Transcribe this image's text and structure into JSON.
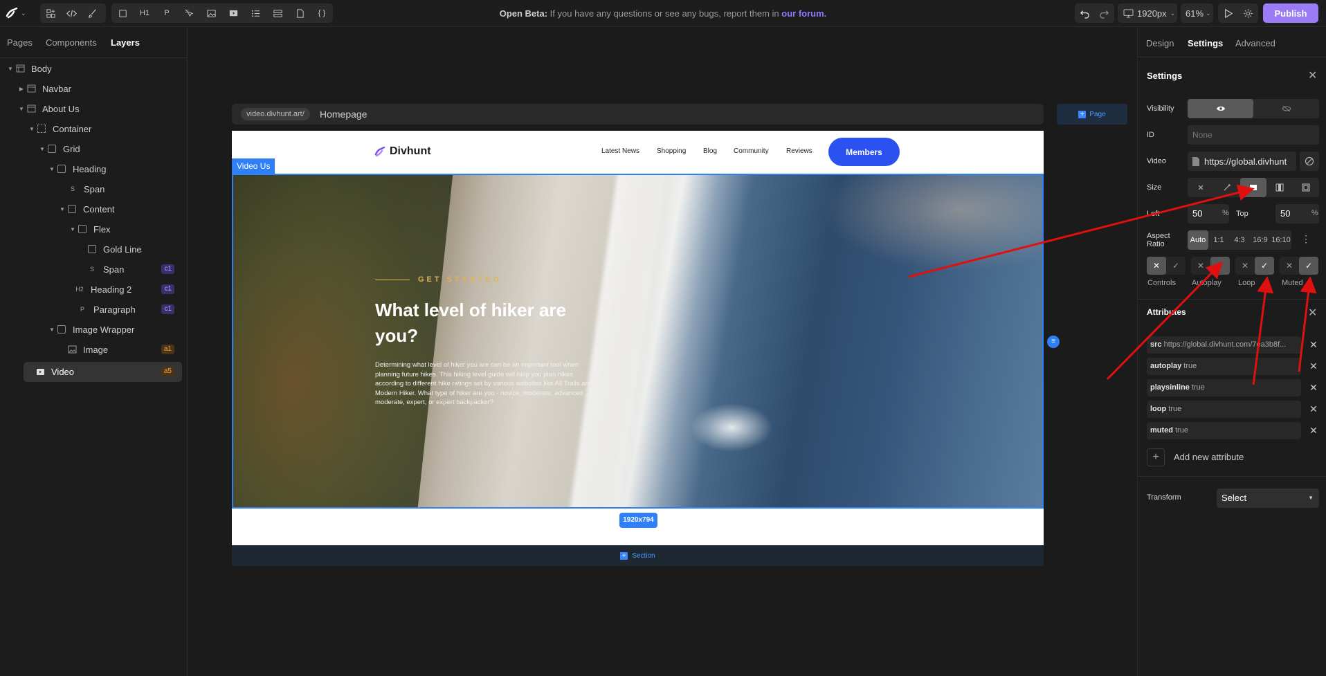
{
  "topbar": {
    "tools": [
      "H1",
      "P",
      "{ }"
    ],
    "beta_prefix": "Open Beta:",
    "beta_text": "If you have any questions or see any bugs, report them in",
    "beta_link": "our forum.",
    "viewport": "1920px",
    "zoom": "61%",
    "publish": "Publish"
  },
  "left_tabs": [
    "Pages",
    "Components",
    "Layers"
  ],
  "layers": [
    {
      "label": "Body",
      "badge": ""
    },
    {
      "label": "Navbar",
      "badge": ""
    },
    {
      "label": "About Us",
      "badge": ""
    },
    {
      "label": "Container",
      "badge": ""
    },
    {
      "label": "Grid",
      "badge": ""
    },
    {
      "label": "Heading",
      "badge": ""
    },
    {
      "label": "Span",
      "badge": "",
      "tag": "S"
    },
    {
      "label": "Content",
      "badge": ""
    },
    {
      "label": "Flex",
      "badge": ""
    },
    {
      "label": "Gold Line",
      "badge": ""
    },
    {
      "label": "Span",
      "badge": "c1",
      "tag": "S"
    },
    {
      "label": "Heading 2",
      "badge": "c1",
      "tag": "H2"
    },
    {
      "label": "Paragraph",
      "badge": "c1",
      "tag": "P"
    },
    {
      "label": "Image Wrapper",
      "badge": ""
    },
    {
      "label": "Image",
      "badge": "a1"
    },
    {
      "label": "Video",
      "badge": "a5"
    }
  ],
  "canvas": {
    "url_domain": "video.divhunt.art/",
    "url_page": "Homepage",
    "page_button": "Page",
    "logo": "Divhunt",
    "nav_links": [
      "Latest News",
      "Shopping",
      "Blog",
      "Community",
      "Reviews"
    ],
    "members": "Members",
    "video_tag": "Video  Us",
    "eyebrow": "GET STARTED",
    "headline": "What level of  hiker are you?",
    "paragraph": "Determining what level of hiker you are can be an important tool when planning future hikes. This hiking level guide will help you plan hikes according to different hike ratings set by various websites like All Trails and Modern Hiker. What type of hiker are you - novice, moderate, advanced moderate, expert, or expert backpacker?",
    "dimensions": "1920x794",
    "section_button": "Section"
  },
  "right_tabs": [
    "Design",
    "Settings",
    "Advanced"
  ],
  "settings": {
    "title": "Settings",
    "visibility_label": "Visibility",
    "id_label": "ID",
    "id_placeholder": "None",
    "video_label": "Video",
    "video_value": "https://global.divhunt",
    "size_label": "Size",
    "left_label": "Left",
    "left_value": "50",
    "left_unit": "%",
    "top_label": "Top",
    "top_value": "50",
    "top_unit": "%",
    "aspect_label": "Aspect Ratio",
    "aspect_options": [
      "Auto",
      "1:1",
      "4:3",
      "16:9",
      "16:10"
    ],
    "toggles": [
      "Controls",
      "Autoplay",
      "Loop",
      "Muted"
    ]
  },
  "attributes": {
    "title": "Attributes",
    "items": [
      {
        "name": "src",
        "value": "https://global.divhunt.com/7ea3b8f..."
      },
      {
        "name": "autoplay",
        "value": "true"
      },
      {
        "name": "playsinline",
        "value": "true"
      },
      {
        "name": "loop",
        "value": "true"
      },
      {
        "name": "muted",
        "value": "true"
      }
    ],
    "add_label": "Add new attribute"
  },
  "transform": {
    "label": "Transform",
    "select": "Select"
  },
  "annotation_color": "#e01010"
}
